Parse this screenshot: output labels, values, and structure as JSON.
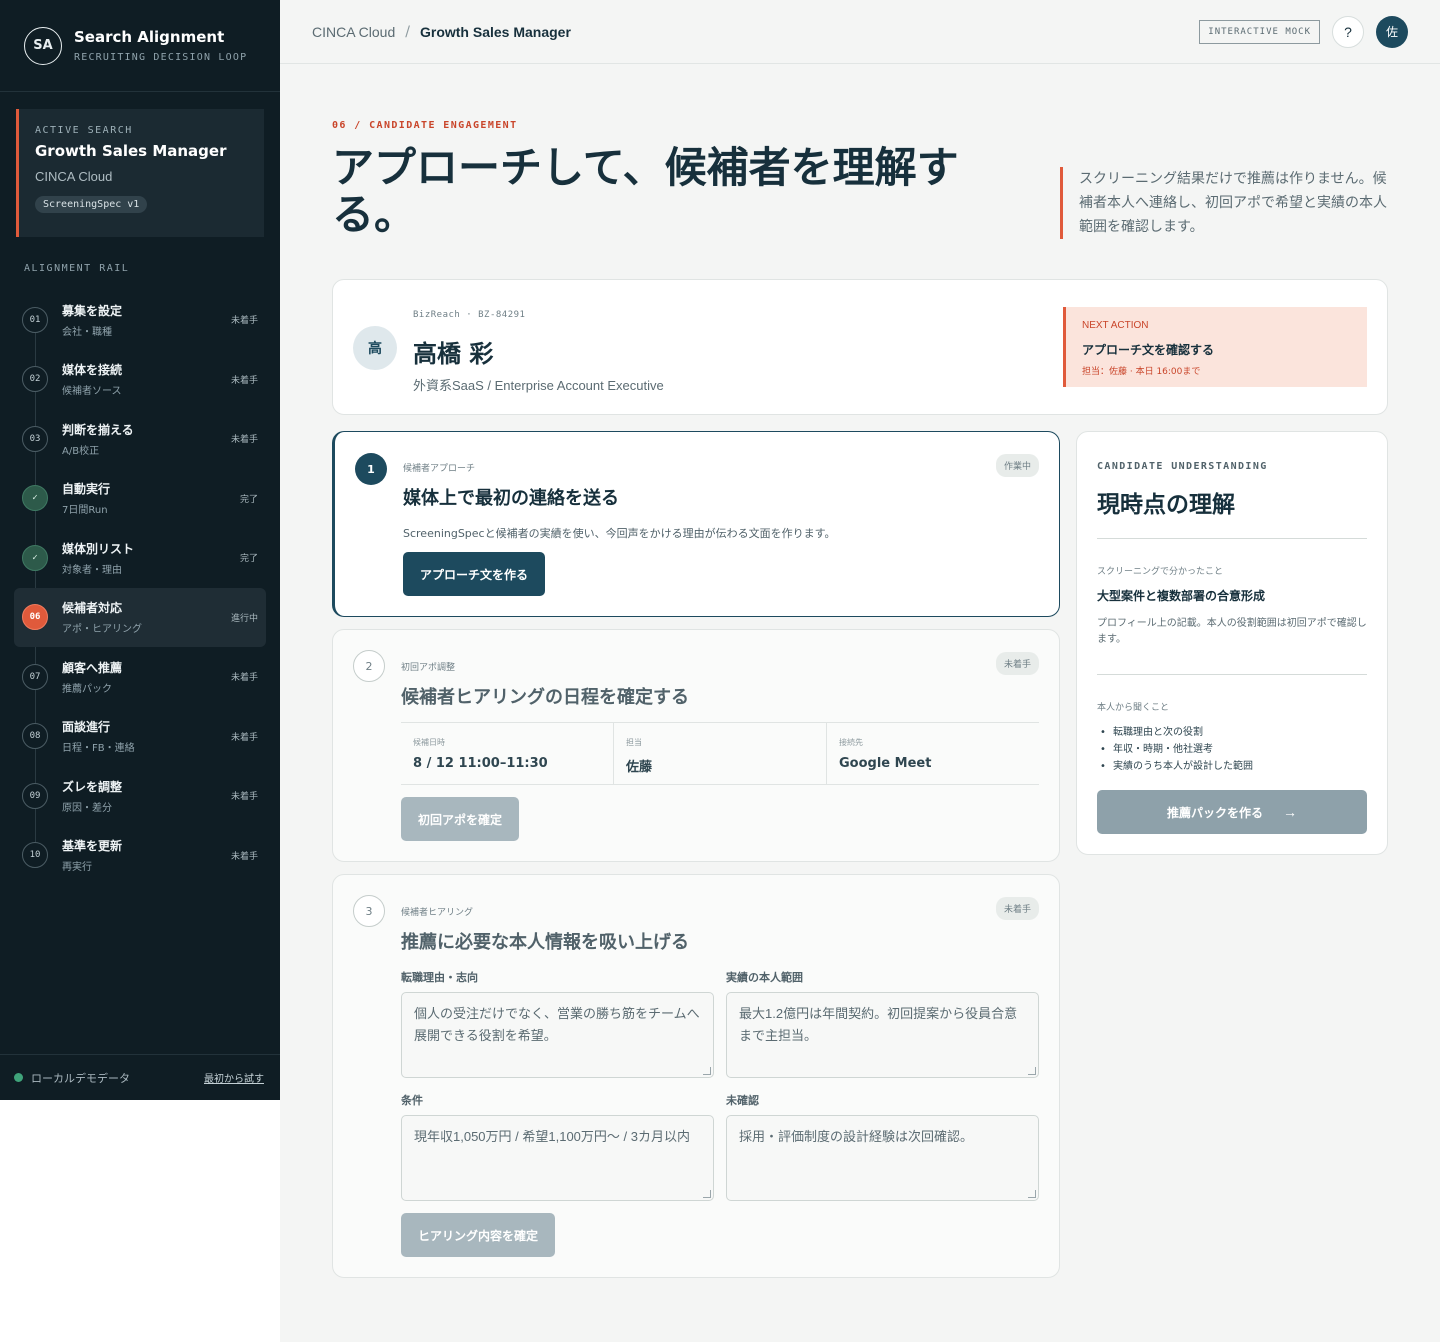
{
  "brand": {
    "logo": "SA",
    "title": "Search Alignment",
    "subtitle": "RECRUITING DECISION LOOP"
  },
  "active_search": {
    "label": "ACTIVE SEARCH",
    "title": "Growth Sales Manager",
    "company": "CINCA Cloud",
    "spec": "ScreeningSpec v1"
  },
  "rail": {
    "label": "ALIGNMENT RAIL",
    "items": [
      {
        "num": "01",
        "title": "募集を設定",
        "sub": "会社・職種",
        "status": "未着手",
        "state": "todo"
      },
      {
        "num": "02",
        "title": "媒体を接続",
        "sub": "候補者ソース",
        "status": "未着手",
        "state": "todo"
      },
      {
        "num": "03",
        "title": "判断を揃える",
        "sub": "A/B校正",
        "status": "未着手",
        "state": "todo"
      },
      {
        "num": "✓",
        "title": "自動実行",
        "sub": "7日間Run",
        "status": "完了",
        "state": "done"
      },
      {
        "num": "✓",
        "title": "媒体別リスト",
        "sub": "対象者・理由",
        "status": "完了",
        "state": "done"
      },
      {
        "num": "06",
        "title": "候補者対応",
        "sub": "アポ・ヒアリング",
        "status": "進行中",
        "state": "current"
      },
      {
        "num": "07",
        "title": "顧客へ推薦",
        "sub": "推薦パック",
        "status": "未着手",
        "state": "todo"
      },
      {
        "num": "08",
        "title": "面談進行",
        "sub": "日程・FB・連絡",
        "status": "未着手",
        "state": "todo"
      },
      {
        "num": "09",
        "title": "ズレを調整",
        "sub": "原因・差分",
        "status": "未着手",
        "state": "todo"
      },
      {
        "num": "10",
        "title": "基準を更新",
        "sub": "再実行",
        "status": "未着手",
        "state": "todo"
      }
    ]
  },
  "footer": {
    "status": "ローカルデモデータ",
    "reset_link": "最初から試す"
  },
  "topbar": {
    "crumb_root": "CINCA Cloud",
    "crumb_sep": "/",
    "crumb_current": "Growth Sales Manager",
    "mock_tag": "INTERACTIVE MOCK",
    "help": "?",
    "user_initial": "佐"
  },
  "hero": {
    "eyebrow": "06 / CANDIDATE ENGAGEMENT",
    "title": "アプローチして、候補者を理解する。",
    "description": "スクリーニング結果だけで推薦は作りません。候補者本人へ連絡し、初回アポで希望と実績の本人範囲を確認します。"
  },
  "candidate": {
    "initial": "高",
    "meta": "BizReach · BZ-84291",
    "name": "高橋 彩",
    "role": "外資系SaaS / Enterprise Account Executive",
    "next_action": {
      "label": "NEXT ACTION",
      "title": "アプローチ文を確認する",
      "sub": "担当：佐藤 · 本日 16:00まで"
    }
  },
  "steps": [
    {
      "num": "1",
      "kicker": "候補者アプローチ",
      "title": "媒体上で最初の連絡を送る",
      "badge": "作業中",
      "description": "ScreeningSpecと候補者の実績を使い、今回声をかける理由が伝わる文面を作ります。",
      "button": "アプローチ文を作る"
    },
    {
      "num": "2",
      "kicker": "初回アポ調整",
      "title": "候補者ヒアリングの日程を確定する",
      "badge": "未着手",
      "schedule": [
        {
          "label": "候補日時",
          "value": "8 / 12 11:00–11:30"
        },
        {
          "label": "担当",
          "value": "佐藤"
        },
        {
          "label": "接続先",
          "value": "Google Meet"
        }
      ],
      "button": "初回アポを確定"
    },
    {
      "num": "3",
      "kicker": "候補者ヒアリング",
      "title": "推薦に必要な本人情報を吸い上げる",
      "badge": "未着手",
      "fields": [
        {
          "label": "転職理由・志向",
          "value": "個人の受注だけでなく、営業の勝ち筋をチームへ展開できる役割を希望。"
        },
        {
          "label": "実績の本人範囲",
          "value": "最大1.2億円は年間契約。初回提案から役員合意まで主担当。"
        },
        {
          "label": "条件",
          "value": "現年収1,050万円 / 希望1,100万円〜 / 3カ月以内"
        },
        {
          "label": "未確認",
          "value": "採用・評価制度の設計経験は次回確認。"
        }
      ],
      "button": "ヒアリング内容を確定"
    }
  ],
  "understanding": {
    "label": "CANDIDATE UNDERSTANDING",
    "title": "現時点の理解",
    "screening_kicker": "スクリーニングで分かったこと",
    "screening_head": "大型案件と複数部署の合意形成",
    "screening_note": "プロフィール上の記載。本人の役割範囲は初回アポで確認します。",
    "ask_kicker": "本人から聞くこと",
    "ask_items": [
      "転職理由と次の役割",
      "年収・時期・他社選考",
      "実績のうち本人が設計した範囲"
    ],
    "button": "推薦パックを作る",
    "button_arrow": "→"
  },
  "colors": {
    "sidebar": "#0f1d24",
    "accent": "#e05a3b",
    "primary": "#1d4a5e",
    "done": "#2d5a4a"
  }
}
